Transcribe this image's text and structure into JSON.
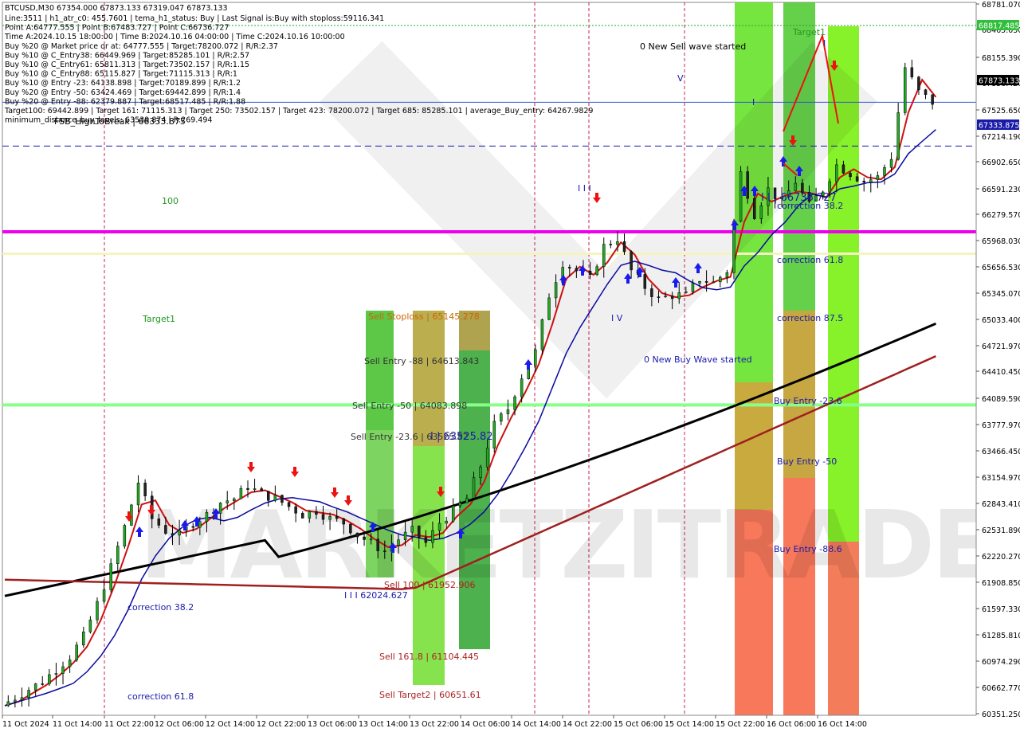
{
  "chart_data": {
    "type": "candlestick",
    "symbol": "BTCUSD,M30",
    "ohlc_header": "BTCUSD,M30  67354.000 67873.133 67319.047 67873.133",
    "info_lines": [
      "Line:3511 | h1_atr_c0: 455.7601 | tema_h1_status: Buy | Last Signal is:Buy with stoploss:59116.341",
      "Point A:64777.555 | Point B:67483.727 | Point C:66736.727",
      "Time A:2024.10.15 18:00:00 | Time B:2024.10.16 04:00:00 | Time C:2024.10.16 10:00:00",
      "Buy %20 @ Market price or at: 64777.555 | Target:78200.072 | R/R:2.37",
      "Buy %10 @ C_Entry38: 66449.969 | Target:85285.101 | R/R:2.57",
      "Buy %10 @ C_Entry61: 65811.313 | Target:73502.157 | R/R:1.15",
      "Buy %10 @ C_Entry88: 65115.827 | Target:71115.313 | R/R:1",
      "Buy %10 @ Entry -23: 64138.898 | Target:70189.899 | R/R:1.2",
      "Buy %20 @ Entry -50: 63424.469 | Target:69442.899 | R/R:1.4",
      "Buy %20 @ Entry -88: 62379.887 | Target:68517.485 | R/R:1.88",
      "Target100: 69442.899 | Target 161: 71115.313 | Target 250: 73502.157 | Target 423: 78200.072 | Target 685: 85285.101 | average_Buy_entry: 64267.9829",
      "minimum_distance_buy_levels: 63539.874 | R:269.494"
    ],
    "y_axis": {
      "min": 60351.25,
      "max": 68817.485,
      "ticks": [
        "68781.070",
        "68465.050",
        "68155.390",
        "67836.420",
        "67525.650",
        "67214.190",
        "66902.650",
        "66591.230",
        "66279.570",
        "65968.030",
        "65656.530",
        "65345.070",
        "65033.400",
        "64721.970",
        "64410.450",
        "64089.590",
        "63777.970",
        "63466.450",
        "63154.970",
        "62843.410",
        "62531.890",
        "62220.270",
        "61908.850",
        "61597.330",
        "61285.810",
        "60974.290",
        "60662.770",
        "60351.250"
      ],
      "current_price": "67873.133",
      "mid_label": "67333.875",
      "top_label": "68817.485"
    },
    "x_axis": {
      "ticks": [
        "11 Oct 2024",
        "11 Oct 14:00",
        "11 Oct 22:00",
        "12 Oct 06:00",
        "12 Oct 14:00",
        "12 Oct 22:00",
        "13 Oct 06:00",
        "13 Oct 14:00",
        "13 Oct 22:00",
        "14 Oct 06:00",
        "14 Oct 14:00",
        "14 Oct 22:00",
        "15 Oct 06:00",
        "15 Oct 14:00",
        "15 Oct 22:00",
        "16 Oct 06:00",
        "16 Oct 14:00"
      ]
    },
    "close_path": [
      [
        0,
        60450
      ],
      [
        2,
        60550
      ],
      [
        4,
        60650
      ],
      [
        6,
        60750
      ],
      [
        8,
        60900
      ],
      [
        10,
        61050
      ],
      [
        12,
        61300
      ],
      [
        14,
        61700
      ],
      [
        16,
        62150
      ],
      [
        18,
        62650
      ],
      [
        20,
        63200
      ],
      [
        22,
        62750
      ],
      [
        24,
        62600
      ],
      [
        26,
        62550
      ],
      [
        28,
        62700
      ],
      [
        30,
        62800
      ],
      [
        32,
        62950
      ],
      [
        34,
        63000
      ],
      [
        36,
        63150
      ],
      [
        38,
        63050
      ],
      [
        40,
        63000
      ],
      [
        42,
        62900
      ],
      [
        44,
        62800
      ],
      [
        46,
        62850
      ],
      [
        48,
        62750
      ],
      [
        50,
        62700
      ],
      [
        52,
        62550
      ],
      [
        54,
        62450
      ],
      [
        56,
        62350
      ],
      [
        58,
        62500
      ],
      [
        60,
        62600
      ],
      [
        62,
        62450
      ],
      [
        64,
        62700
      ],
      [
        66,
        62850
      ],
      [
        68,
        63000
      ],
      [
        70,
        63400
      ],
      [
        72,
        63900
      ],
      [
        74,
        64100
      ],
      [
        76,
        64500
      ],
      [
        78,
        64800
      ],
      [
        80,
        65500
      ],
      [
        82,
        65900
      ],
      [
        84,
        65800
      ],
      [
        86,
        65700
      ],
      [
        88,
        66100
      ],
      [
        90,
        66200
      ],
      [
        92,
        65800
      ],
      [
        94,
        65600
      ],
      [
        96,
        65450
      ],
      [
        98,
        65500
      ],
      [
        100,
        65500
      ],
      [
        102,
        65700
      ],
      [
        104,
        65650
      ],
      [
        106,
        65800
      ],
      [
        108,
        67000
      ],
      [
        110,
        66500
      ],
      [
        112,
        66800
      ],
      [
        114,
        66650
      ],
      [
        116,
        66900
      ],
      [
        118,
        66600
      ],
      [
        120,
        66800
      ],
      [
        122,
        67100
      ],
      [
        124,
        67000
      ],
      [
        126,
        66900
      ],
      [
        128,
        66950
      ],
      [
        130,
        67200
      ],
      [
        132,
        68300
      ],
      [
        134,
        68000
      ],
      [
        136,
        67873
      ]
    ],
    "horizontal_lines": [
      {
        "price": 68817.485,
        "color": "#22aa22",
        "style": "dotted"
      },
      {
        "price": 67873.133,
        "color": "#3355cc",
        "style": "solid"
      },
      {
        "price": 67333.875,
        "color": "#1a1aaa",
        "style": "dashed"
      },
      {
        "price": 66279.57,
        "color": "#ee00ee",
        "style": "solid"
      },
      {
        "price": 66010,
        "color": "#ffffcc",
        "style": "solid"
      },
      {
        "price": 64150,
        "color": "#88ff88",
        "style": "solid"
      }
    ],
    "labels": [
      {
        "text": "0 New Sell wave started",
        "color": "#000000"
      },
      {
        "text": "0 New Buy Wave started",
        "color": "#1a1aaa"
      },
      {
        "text": "Target1",
        "color": "#229922"
      },
      {
        "text": "Target1",
        "color": "#229922"
      },
      {
        "text": "100",
        "color": "#229922"
      },
      {
        "text": "Sell Stoploss | 65145.278",
        "color": "#cc6600"
      },
      {
        "text": "Sell Entry -88 | 64613.843",
        "color": "#333333"
      },
      {
        "text": "Sell Entry -50 | 64083.898",
        "color": "#333333"
      },
      {
        "text": "Sell Entry -23.6 | 63525.82",
        "color": "#333333"
      },
      {
        "text": "I | 63525.82",
        "color": "#1a1aaa"
      },
      {
        "text": "Sell 100 | 61952.906",
        "color": "#aa2222"
      },
      {
        "text": "Sell 161.8 | 61104.445",
        "color": "#aa2222"
      },
      {
        "text": "Sell Target2 | 60651.61",
        "color": "#aa2222"
      },
      {
        "text": "I I I 62024.627",
        "color": "#1a1aaa"
      },
      {
        "text": "I I | 66736.727",
        "color": "#1a1aaa"
      },
      {
        "text": "correction 38.2",
        "color": "#1a1aaa"
      },
      {
        "text": "correction 61.8",
        "color": "#1a1aaa"
      },
      {
        "text": "correction 87.5",
        "color": "#1a1aaa"
      },
      {
        "text": "Buy Entry -23.6",
        "color": "#1a1aaa"
      },
      {
        "text": "Buy Entry -50",
        "color": "#1a1aaa"
      },
      {
        "text": "Buy Entry -88.6",
        "color": "#1a1aaa"
      },
      {
        "text": "correction 38.2",
        "color": "#1a1aaa"
      },
      {
        "text": "correction 61.8",
        "color": "#1a1aaa"
      },
      {
        "text": "FSB_HighToBreak | 66333.875",
        "color": "#000000"
      },
      {
        "text": "I V",
        "color": "#1a1aaa"
      },
      {
        "text": "V",
        "color": "#1a1aaa"
      },
      {
        "text": "I I I",
        "color": "#1a1aaa"
      },
      {
        "text": "I",
        "color": "#1a1aaa"
      },
      {
        "text": "I",
        "color": "#1a1aaa"
      }
    ],
    "watermark": "MARKETZITRADE",
    "colors": {
      "bull": "#22aa22",
      "bear": "#222222",
      "ema_red": "#cc1111",
      "ema_blue": "#0a0aa0",
      "ema_black": "#000000",
      "ema_brown": "#a02020",
      "magenta": "#ee00ee"
    }
  }
}
